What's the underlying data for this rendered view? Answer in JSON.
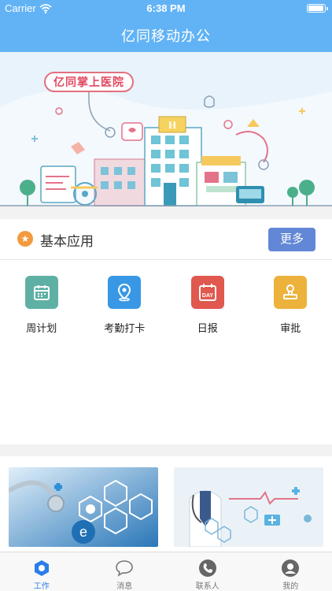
{
  "status_bar": {
    "carrier": "Carrier",
    "time": "6:38 PM",
    "battery_level": 1.0
  },
  "nav": {
    "title": "亿同移动办公"
  },
  "banner": {
    "sign_text": "亿同掌上医院",
    "hospital_letter": "H",
    "calendar_text": "DAY"
  },
  "basic_apps": {
    "title": "基本应用",
    "more_label": "更多",
    "items": [
      {
        "label": "周计划",
        "icon": "weekly-plan-icon",
        "color": "#5fb0a4"
      },
      {
        "label": "考勤打卡",
        "icon": "location-pin-icon",
        "color": "#3898e5"
      },
      {
        "label": "日报",
        "icon": "calendar-day-icon",
        "color": "#e0584e"
      },
      {
        "label": "审批",
        "icon": "approval-stamp-icon",
        "color": "#ecb23b"
      }
    ]
  },
  "tabs": [
    {
      "label": "工作",
      "icon": "work-icon",
      "active": true
    },
    {
      "label": "消息",
      "icon": "message-bubble-icon",
      "active": false
    },
    {
      "label": "联系人",
      "icon": "phone-icon",
      "active": false
    },
    {
      "label": "我的",
      "icon": "profile-icon",
      "active": false
    }
  ],
  "colors": {
    "header": "#62b3f5",
    "more_button": "#6287d6",
    "active_tab": "#2b7de9",
    "star_badge": "#f39a3f"
  }
}
